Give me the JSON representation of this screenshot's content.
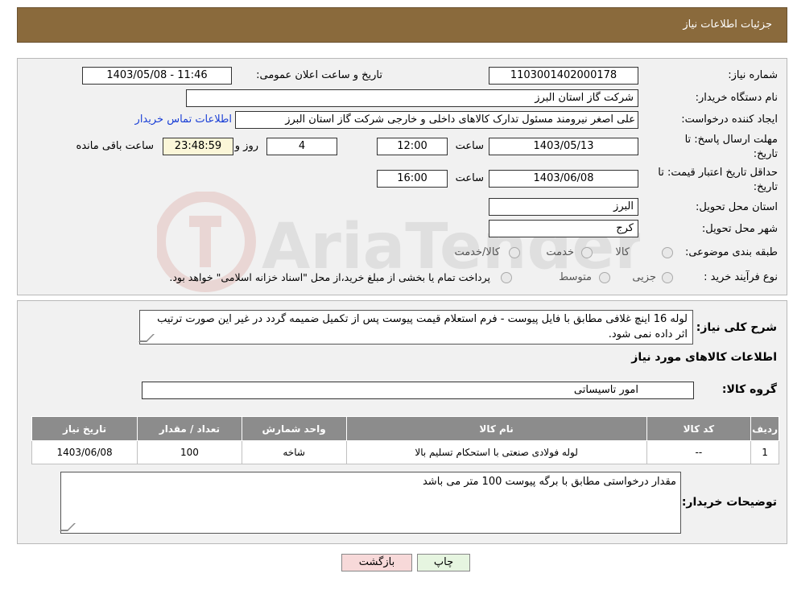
{
  "header": {
    "title": "جزئیات اطلاعات نیاز"
  },
  "form": {
    "need_number_label": "شماره نیاز:",
    "need_number": "1103001402000178",
    "announce_label": "تاریخ و ساعت اعلان عمومی:",
    "announce_value": "1403/05/08 - 11:46",
    "buyer_org_label": "نام دستگاه خریدار:",
    "buyer_org": "شرکت گاز استان البرز",
    "creator_label": "ایجاد کننده درخواست:",
    "creator": "علی اصغر نیرومند مسئول تدارک کالاهای داخلی و خارجی شرکت گاز استان البرز",
    "contact_link": "اطلاعات تماس خریدار",
    "reply_deadline_label_1": "مهلت ارسال پاسخ: تا",
    "reply_deadline_label_2": "تاریخ:",
    "reply_date": "1403/05/13",
    "time_label": "ساعت",
    "reply_time": "12:00",
    "days_value": "4",
    "days_label": "روز و",
    "remaining_time": "23:48:59",
    "remaining_label": "ساعت باقی مانده",
    "validity_label_1": "حداقل تاریخ اعتبار قیمت: تا",
    "validity_label_2": "تاریخ:",
    "validity_date": "1403/06/08",
    "validity_time": "16:00",
    "province_label": "استان محل تحویل:",
    "province": "البرز",
    "city_label": "شهر محل تحویل:",
    "city": "کرج",
    "category_label": "طبقه بندی موضوعی:",
    "category_options": [
      "کالا",
      "خدمت",
      "کالا/خدمت"
    ],
    "process_label": "نوع فرآیند خرید :",
    "process_options": [
      "جزیی",
      "متوسط"
    ],
    "process_note": "پرداخت تمام یا بخشی از مبلغ خرید،از محل \"اسناد خزانه اسلامی\" خواهد بود."
  },
  "summary": {
    "label": "شرح کلی نیاز:",
    "text": "لوله 16 اینچ غلافی مطابق با فایل پیوست - فرم استعلام قیمت پیوست پس از تکمیل ضمیمه گردد در غیر این صورت ترتیب اثر داده نمی شود.",
    "items_title": "اطلاعات کالاهای مورد نیاز",
    "group_label": "گروه کالا:",
    "group_value": "امور تاسیساتی"
  },
  "table": {
    "headers": [
      "ردیف",
      "کد کالا",
      "نام کالا",
      "واحد شمارش",
      "تعداد / مقدار",
      "تاریخ نیاز"
    ],
    "rows": [
      [
        "1",
        "--",
        "لوله فولادی صنعتی با استحکام تسلیم بالا",
        "شاخه",
        "100",
        "1403/06/08"
      ]
    ]
  },
  "buyer_notes": {
    "label": "توضیحات خریدار:",
    "text": "مقدار درخواستی مطابق با برگه پیوست 100 متر می باشد"
  },
  "buttons": {
    "print": "چاپ",
    "back": "بازگشت"
  },
  "watermark": {
    "text": "AriaTender.neT"
  },
  "colors": {
    "header_bg": "#8a6a3c",
    "table_header": "#8c8c8c",
    "link": "#1a3fd6",
    "back_btn": "#f7d9d9",
    "print_btn": "#e6f5e0"
  }
}
